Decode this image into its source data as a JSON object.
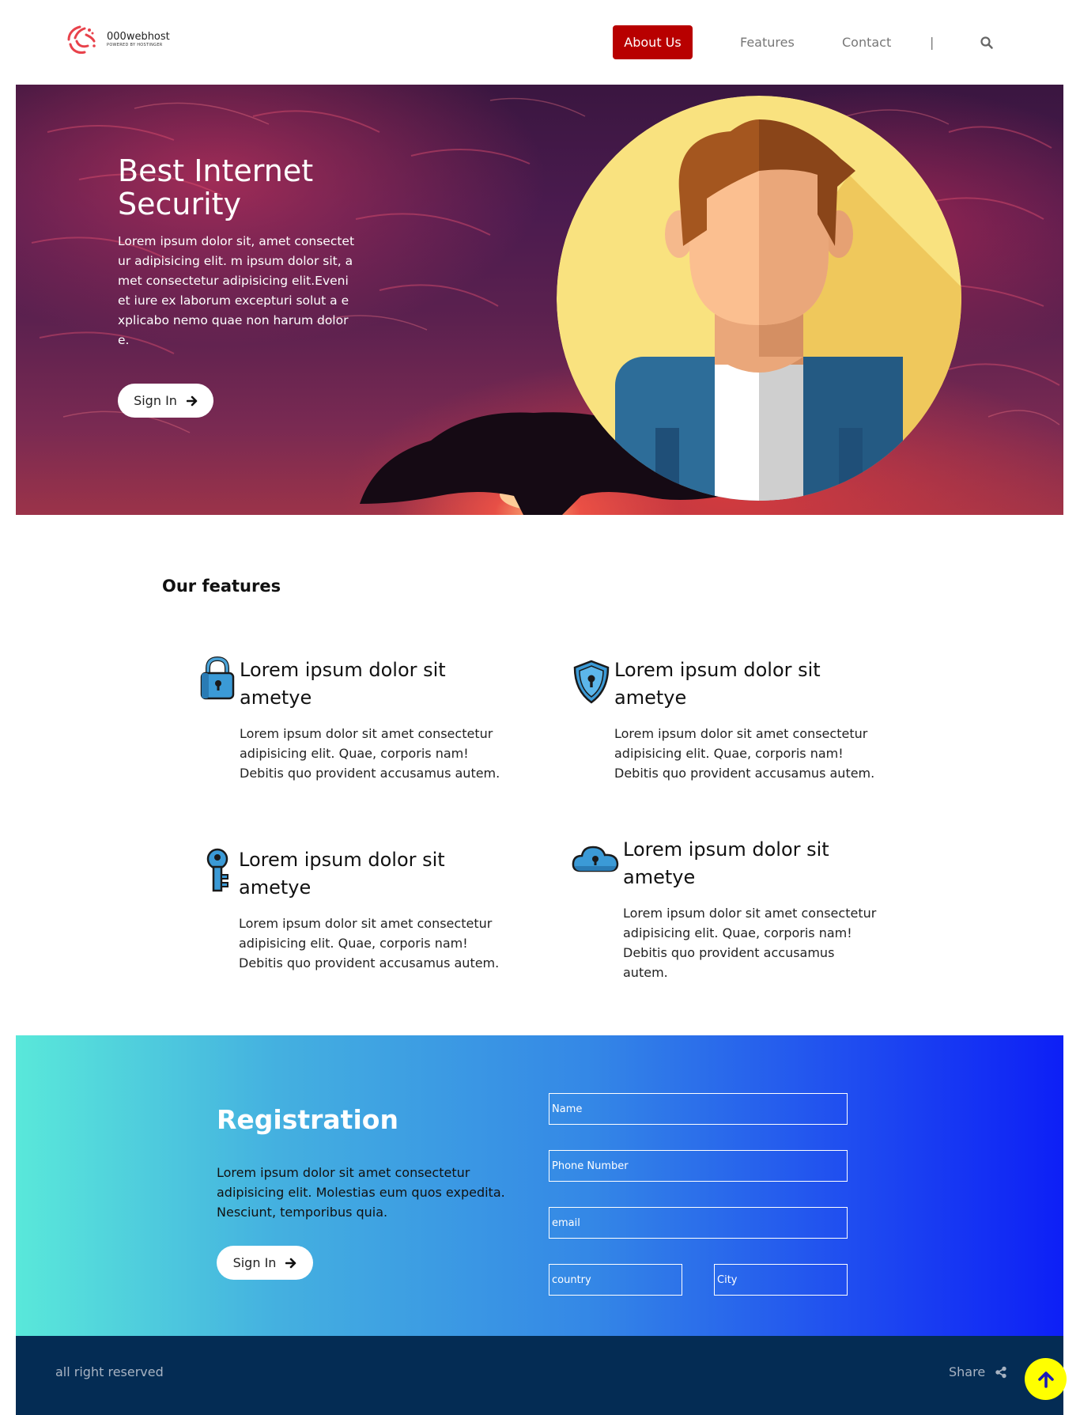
{
  "header": {
    "logo_name": "000webhost",
    "logo_sub": "POWERED BY HOSTINGER",
    "nav": {
      "about": "About Us",
      "features": "Features",
      "contact": "Contact",
      "separator": "|"
    },
    "icons": {
      "search": "search-icon"
    }
  },
  "hero": {
    "title": "Best Internet Security",
    "text": "Lorem ipsum dolor sit, amet consectetur adipisicing elit. m ipsum dolor sit, amet consectetur adipisicing elit.Eveniet iure ex laborum excepturi solut a explicabo nemo quae non harum dolore.",
    "button": "Sign In"
  },
  "features": {
    "title": "Our features",
    "items": [
      {
        "icon": "padlock-icon",
        "title": "Lorem ipsum dolor sit ametye",
        "text": "Lorem ipsum dolor sit amet consectetur adipisicing elit. Quae, corporis nam! Debitis quo provident accusamus autem."
      },
      {
        "icon": "shield-icon",
        "title": "Lorem ipsum dolor sit ametye",
        "text": "Lorem ipsum dolor sit amet consectetur adipisicing elit. Quae, corporis nam! Debitis quo provident accusamus autem."
      },
      {
        "icon": "key-icon",
        "title": "Lorem ipsum dolor sit ametye",
        "text": "Lorem ipsum dolor sit amet consectetur adipisicing elit. Quae, corporis nam! Debitis quo provident accusamus autem."
      },
      {
        "icon": "cloud-lock-icon",
        "title": "Lorem ipsum dolor sit ametye",
        "text": "Lorem ipsum dolor sit amet consectetur adipisicing elit. Quae, corporis nam! Debitis quo provident accusamus autem."
      }
    ]
  },
  "registration": {
    "title": "Registration",
    "text": "Lorem ipsum dolor sit amet consectetur adipisicing elit. Molestias eum quos expedita. Nesciunt, temporibus quia.",
    "button": "Sign In",
    "fields": {
      "name": "Name",
      "phone": "Phone Number",
      "email": "email",
      "country": "country",
      "city": "City"
    }
  },
  "footer": {
    "copyright": "all right reserved",
    "share": "Share"
  },
  "colors": {
    "nav_active": "#b80000",
    "footer_bg": "#042c54",
    "to_top": "#ffff00",
    "reg_gradient_start": "#59e8da",
    "reg_gradient_end": "#0d1ff6"
  }
}
